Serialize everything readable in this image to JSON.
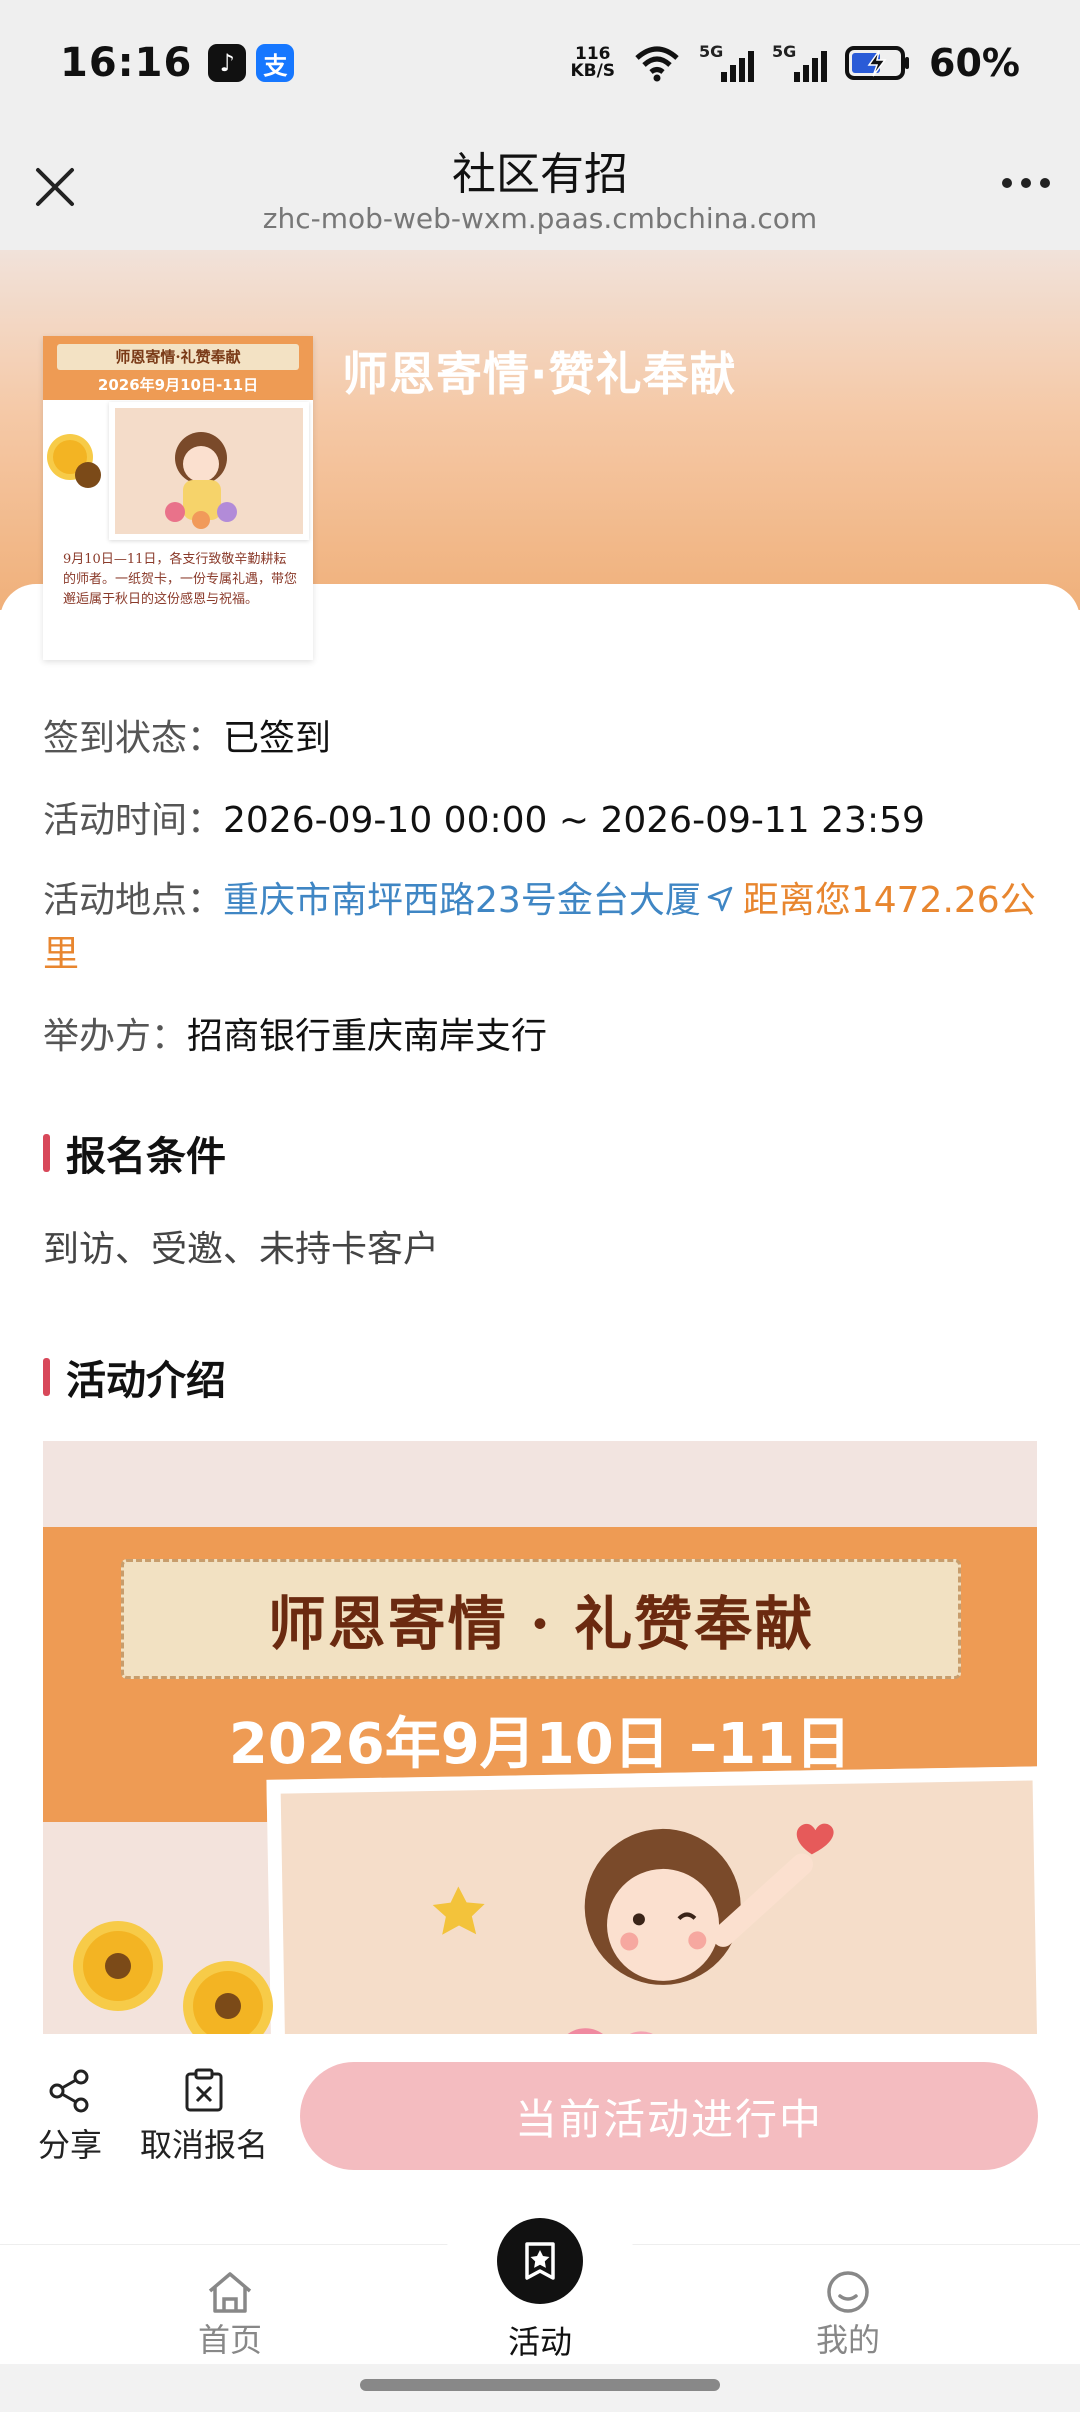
{
  "status_bar": {
    "time": "16:16",
    "speed_value": "116",
    "speed_unit": "KB/S",
    "battery": "60%",
    "network_1": "5G",
    "network_2": "5G"
  },
  "title_bar": {
    "title": "社区有招",
    "url": "zhc-mob-web-wxm.paas.cmbchina.com"
  },
  "activity": {
    "title": "师恩寄情·赞礼奉献",
    "thumb_banner": "师恩寄情·礼赞奉献",
    "thumb_date": "2026年9月10日-11日",
    "thumb_text": "9月10日—11日，各支行致敬辛勤耕耘的师者。一纸贺卡，一份专属礼遇，带您邂逅属于秋日的这份感恩与祝福。",
    "signin_label": "签到状态：",
    "signin_value": "已签到",
    "time_label": "活动时间：",
    "time_value": "2026-09-10 00:00 ~ 2026-09-11 23:59",
    "location_label": "活动地点：",
    "location_value": "重庆市南坪西路23号金台大厦",
    "distance": "距离您1472.26公里",
    "organizer_label": "举办方：",
    "organizer_value": "招商银行重庆南岸支行"
  },
  "sections": {
    "conditions_title": "报名条件",
    "conditions_value": "到访、受邀、未持卡客户",
    "intro_title": "活动介绍"
  },
  "poster": {
    "banner": "师恩寄情 · 礼赞奉献",
    "date": "2026年9月10日 –11日"
  },
  "actions": {
    "share": "分享",
    "cancel": "取消报名",
    "cta": "当前活动进行中"
  },
  "tabs": {
    "home": "首页",
    "activity": "活动",
    "mine": "我的"
  },
  "colors": {
    "accent_link": "#3f86c4",
    "accent_orange": "#e8862f",
    "section_bar": "#d8485a",
    "cta_bg": "#f4bcc0"
  }
}
